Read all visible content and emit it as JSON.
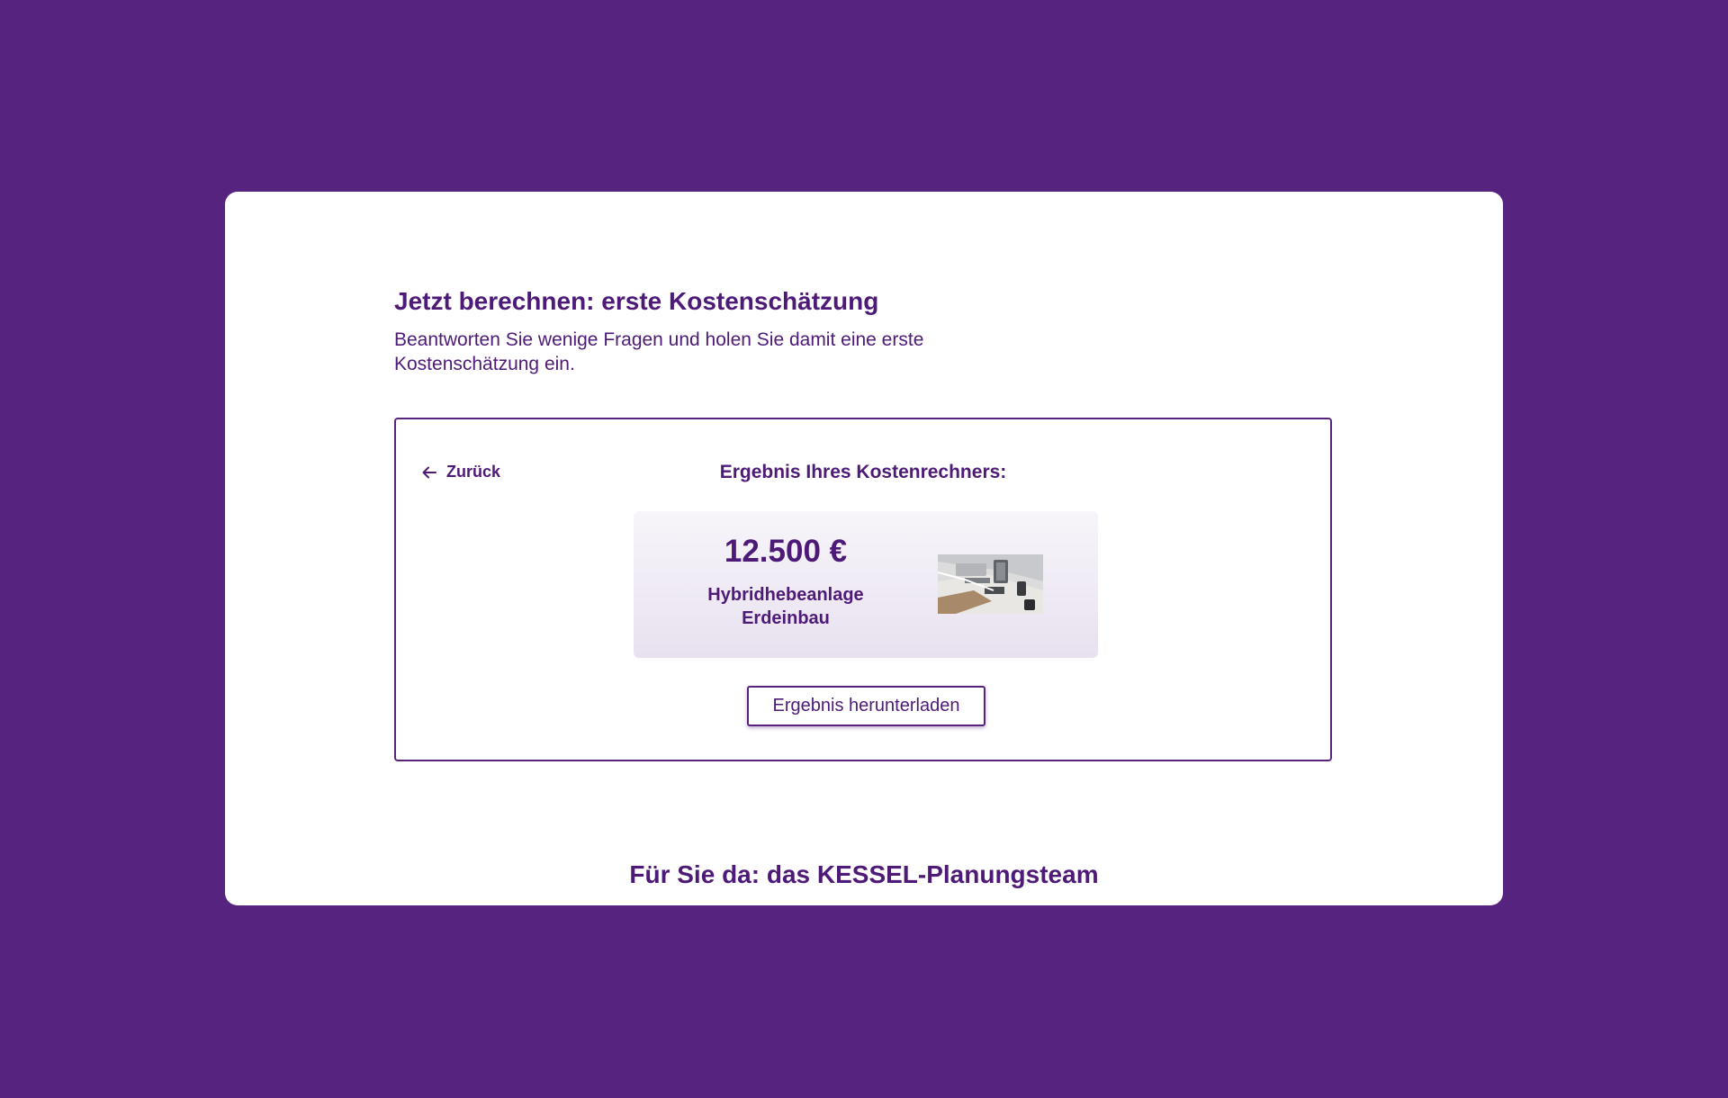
{
  "intro": {
    "title": "Jetzt berechnen: erste Kostenschätzung",
    "description": "Beantworten Sie wenige Fragen und holen Sie damit eine erste Kostenschätzung ein."
  },
  "calculator": {
    "back_label": "Zurück",
    "back_icon": "arrow-left-icon",
    "result_heading": "Ergebnis Ihres Kostenrechners:",
    "result": {
      "price": "12.500 €",
      "product_line1": "Hybridhebeanlage",
      "product_line2": "Erdeinbau",
      "image": "product-photo"
    },
    "download_label": "Ergebnis herunterladen"
  },
  "team": {
    "title": "Für Sie da: das KESSEL-Planungsteam"
  },
  "colors": {
    "background": "#56237e",
    "card": "#ffffff",
    "text": "#4e1a78",
    "panel_top": "#f7f5fa",
    "panel_bottom": "#e8e1ef"
  }
}
